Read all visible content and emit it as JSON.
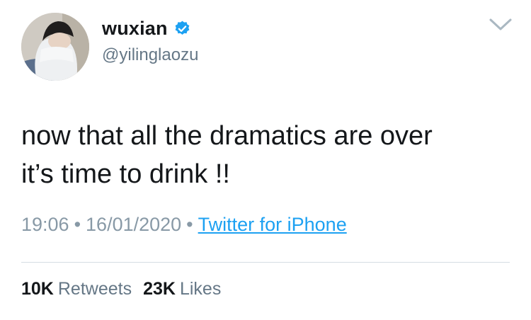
{
  "author": {
    "display_name": "wuxian",
    "handle": "@yilinglaozu",
    "verified": true,
    "verified_color": "#1da1f2",
    "avatar_icon": "avatar-photo"
  },
  "tweet": {
    "text": "now that all the dramatics are over\nit’s time to drink !!",
    "time": "19:06",
    "date": "16/01/2020",
    "separator": "•",
    "source": "Twitter for iPhone"
  },
  "stats": {
    "retweets_count": "10K",
    "retweets_label": "Retweets",
    "likes_count": "23K",
    "likes_label": "Likes"
  },
  "icons": {
    "menu": "chevron-down-icon",
    "verified": "verified-badge-icon"
  },
  "colors": {
    "text": "#14171a",
    "secondary": "#657786",
    "meta": "#8899a6",
    "link": "#1da1f2",
    "divider": "#d6dde3"
  }
}
